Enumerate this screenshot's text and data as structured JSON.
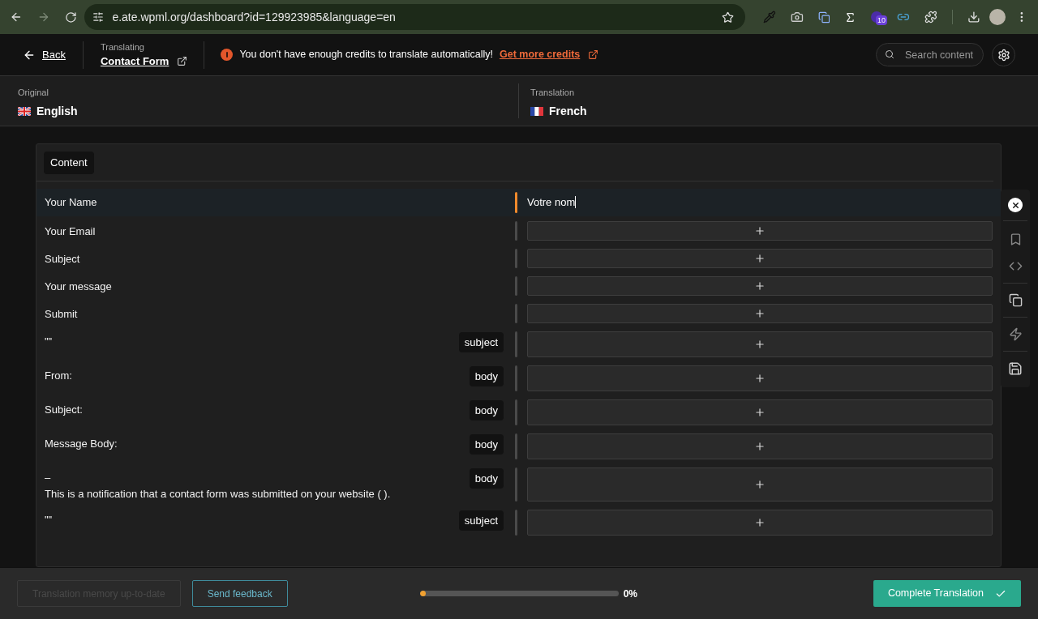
{
  "browser": {
    "url": "e.ate.wpml.org/dashboard?id=129923985&language=en",
    "forward_disabled": true,
    "extension_badge": "10"
  },
  "header": {
    "back": "Back",
    "translating_label": "Translating",
    "document": "Contact Form",
    "warning": "You don't have enough credits to translate automatically!",
    "warning_link": "Get more credits",
    "search": {
      "placeholder": "Search content"
    }
  },
  "languages": {
    "original_label": "Original",
    "original": "English",
    "translation_label": "Translation",
    "translation": "French"
  },
  "section": {
    "title": "Content"
  },
  "rows": [
    {
      "source": "Your Name",
      "translation": "Votre nom",
      "selected": true
    },
    {
      "source": "Your Email",
      "selected": false
    },
    {
      "source": "Subject",
      "selected": false
    },
    {
      "source": "Your message",
      "selected": false
    },
    {
      "source": "Submit",
      "selected": false
    },
    {
      "source": "\"\"",
      "tag": "subject",
      "selected": false
    },
    {
      "source": "From:",
      "tag": "body",
      "selected": false
    },
    {
      "source": "Subject:",
      "tag": "body",
      "selected": false
    },
    {
      "source": "Message Body:",
      "tag": "body",
      "selected": false
    },
    {
      "source": "–",
      "source_line_2": "This is a notification that a contact form was submitted on your website ( ).",
      "tag": "body",
      "selected": false
    },
    {
      "source": "\"\"",
      "tag": "subject",
      "selected": false
    }
  ],
  "footer": {
    "memory_button": {
      "label": "Translation memory up-to-date",
      "disabled": true
    },
    "feedback_button": "Send feedback",
    "progress": {
      "level": 0.02,
      "reading": "0%"
    },
    "complete_button": "Complete Translation"
  }
}
